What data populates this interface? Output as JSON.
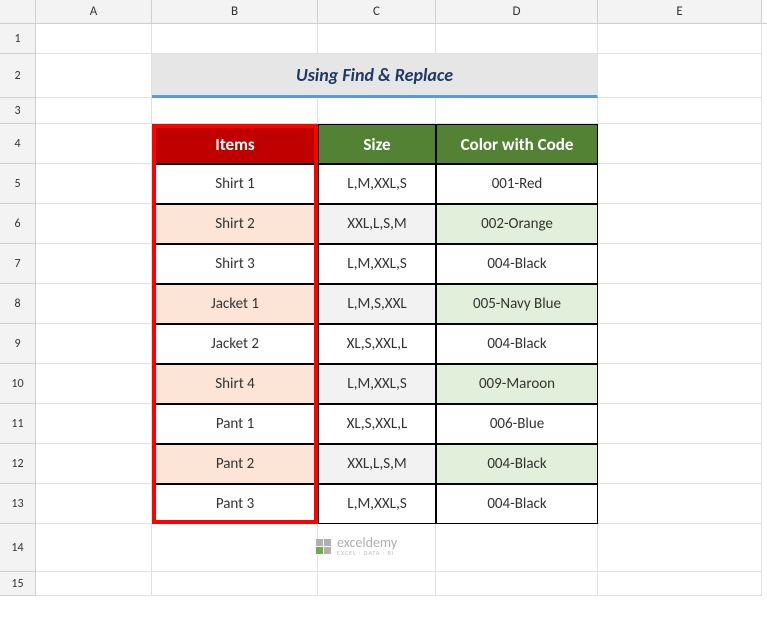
{
  "columns": [
    "A",
    "B",
    "C",
    "D",
    "E"
  ],
  "rows": [
    "1",
    "2",
    "3",
    "4",
    "5",
    "6",
    "7",
    "8",
    "9",
    "10",
    "11",
    "12",
    "13",
    "14",
    "15"
  ],
  "title": "Using Find & Replace",
  "headers": {
    "items": "Items",
    "size": "Size",
    "color": "Color with Code"
  },
  "table": [
    {
      "item": "Shirt 1",
      "size": "L,M,XXL,S",
      "color": "001-Red",
      "alt": false
    },
    {
      "item": "Shirt 2",
      "size": "XXL,L,S,M",
      "color": "002-Orange",
      "alt": true
    },
    {
      "item": "Shirt 3",
      "size": "L,M,XXL,S",
      "color": "004-Black",
      "alt": false
    },
    {
      "item": "Jacket 1",
      "size": "L,M,S,XXL",
      "color": "005-Navy Blue",
      "alt": true
    },
    {
      "item": "Jacket 2",
      "size": "XL,S,XXL,L",
      "color": "004-Black",
      "alt": false
    },
    {
      "item": "Shirt 4",
      "size": "L,M,XXL,S",
      "color": "009-Maroon",
      "alt": true
    },
    {
      "item": "Pant 1",
      "size": "XL,S,XXL,L",
      "color": "006-Blue",
      "alt": false
    },
    {
      "item": "Pant 2",
      "size": "XXL,L,S,M",
      "color": "004-Black",
      "alt": true
    },
    {
      "item": "Pant 3",
      "size": "L,M,XXL,S",
      "color": "004-Black",
      "alt": false
    }
  ],
  "watermark": {
    "brand": "exceldemy",
    "tagline": "EXCEL · DATA · BI"
  }
}
